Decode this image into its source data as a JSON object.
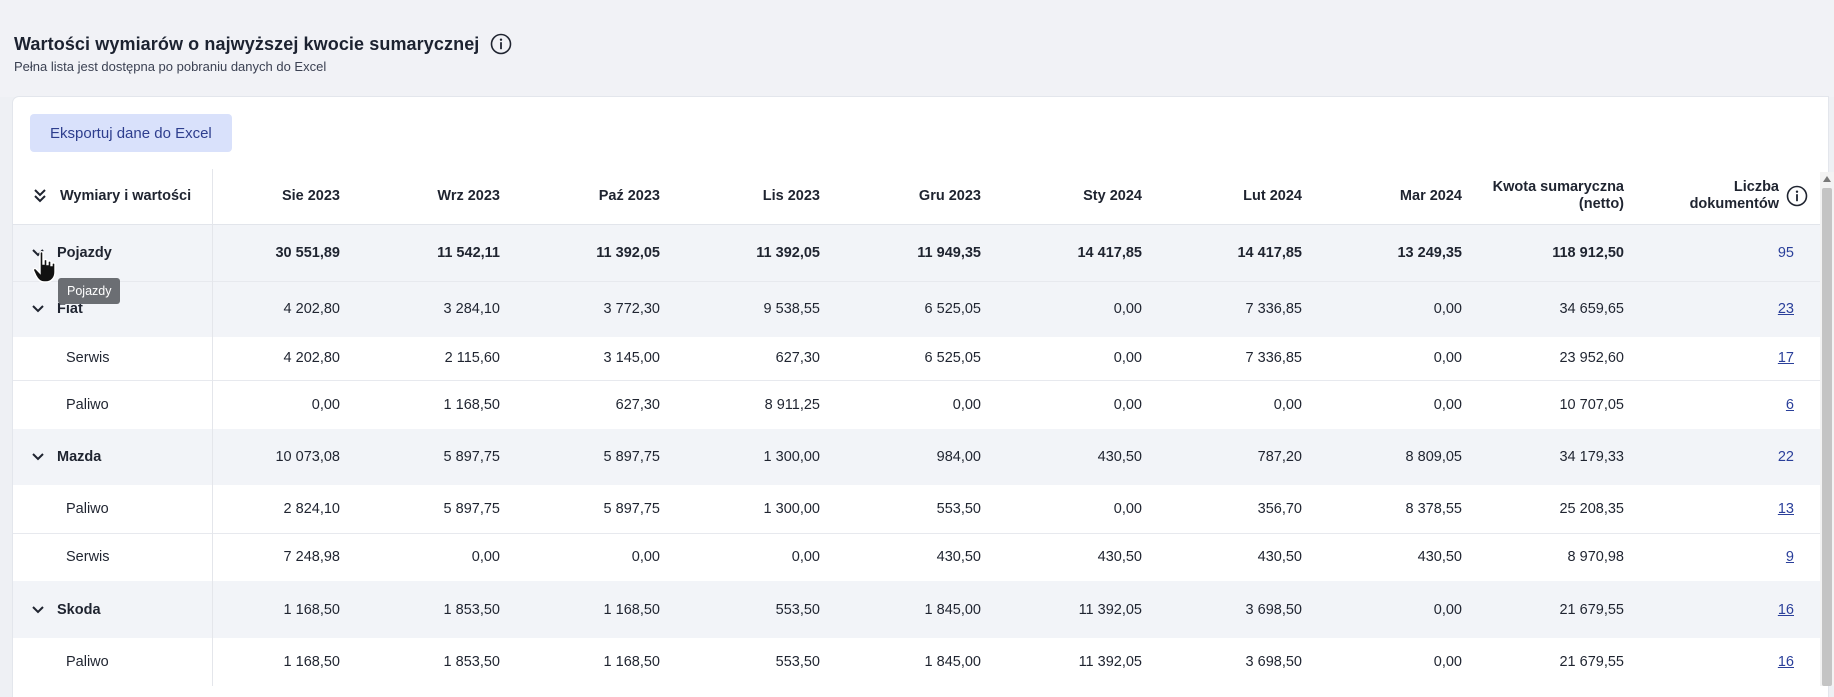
{
  "section": {
    "title": "Wartości wymiarów o najwyższej kwocie sumarycznej",
    "subtitle": "Pełna lista jest dostępna po pobraniu danych do Excel"
  },
  "toolbar": {
    "export_label": "Eksportuj dane do Excel"
  },
  "table": {
    "columns": [
      {
        "label": "Wymiary i wartości"
      },
      {
        "label": "Sie 2023"
      },
      {
        "label": "Wrz 2023"
      },
      {
        "label": "Paź 2023"
      },
      {
        "label": "Lis 2023"
      },
      {
        "label": "Gru 2023"
      },
      {
        "label": "Sty 2024"
      },
      {
        "label": "Lut 2024"
      },
      {
        "label": "Mar 2024"
      },
      {
        "label_line1": "Kwota sumaryczna",
        "label_line2": "(netto)"
      },
      {
        "label_line1": "Liczba",
        "label_line2": "dokumentów"
      }
    ],
    "rows": [
      {
        "name": "Pojazdy",
        "values": [
          "30 551,89",
          "11 542,11",
          "11 392,05",
          "11 392,05",
          "11 949,35",
          "14 417,85",
          "14 417,85",
          "13 249,35",
          "118 912,50"
        ],
        "docs": "95"
      },
      {
        "name": "Fiat",
        "values": [
          "4 202,80",
          "3 284,10",
          "3 772,30",
          "9 538,55",
          "6 525,05",
          "0,00",
          "7 336,85",
          "0,00",
          "34 659,65"
        ],
        "docs": "23"
      },
      {
        "name": "Serwis",
        "values": [
          "4 202,80",
          "2 115,60",
          "3 145,00",
          "627,30",
          "6 525,05",
          "0,00",
          "7 336,85",
          "0,00",
          "23 952,60"
        ],
        "docs": "17"
      },
      {
        "name": "Paliwo",
        "values": [
          "0,00",
          "1 168,50",
          "627,30",
          "8 911,25",
          "0,00",
          "0,00",
          "0,00",
          "0,00",
          "10 707,05"
        ],
        "docs": "6"
      },
      {
        "name": "Mazda",
        "values": [
          "10 073,08",
          "5 897,75",
          "5 897,75",
          "1 300,00",
          "984,00",
          "430,50",
          "787,20",
          "8 809,05",
          "34 179,33"
        ],
        "docs": "22"
      },
      {
        "name": "Paliwo",
        "values": [
          "2 824,10",
          "5 897,75",
          "5 897,75",
          "1 300,00",
          "553,50",
          "0,00",
          "356,70",
          "8 378,55",
          "25 208,35"
        ],
        "docs": "13"
      },
      {
        "name": "Serwis",
        "values": [
          "7 248,98",
          "0,00",
          "0,00",
          "0,00",
          "430,50",
          "430,50",
          "430,50",
          "430,50",
          "8 970,98"
        ],
        "docs": "9"
      },
      {
        "name": "Skoda",
        "values": [
          "1 168,50",
          "1 853,50",
          "1 168,50",
          "553,50",
          "1 845,00",
          "11 392,05",
          "3 698,50",
          "0,00",
          "21 679,55"
        ],
        "docs": "16"
      },
      {
        "name": "Paliwo",
        "values": [
          "1 168,50",
          "1 853,50",
          "1 168,50",
          "553,50",
          "1 845,00",
          "11 392,05",
          "3 698,50",
          "0,00",
          "21 679,55"
        ],
        "docs": "16"
      }
    ]
  },
  "tooltip": {
    "text": "Pojazdy"
  },
  "icons": {
    "info": "info-circle-icon",
    "expand_all": "double-chevron-down-icon",
    "row_toggle": "chevron-down-icon",
    "cursor": "hand-pointer-icon"
  },
  "colors": {
    "accent": "#2a3f9a",
    "button_bg": "#d9e1fb",
    "group_row_bg": "#f2f4f8",
    "tooltip_bg": "#6b6e73"
  }
}
